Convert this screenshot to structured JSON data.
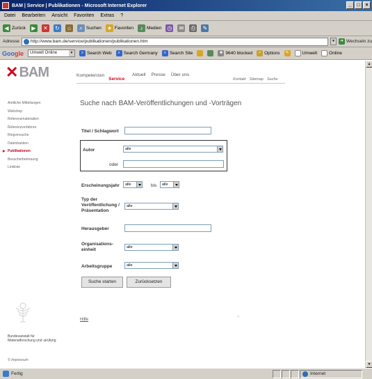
{
  "window": {
    "title": "BAM | Service | Publikationen - Microsoft Internet Explorer",
    "buttons": [
      "_",
      "□",
      "×"
    ]
  },
  "menubar": [
    "Datei",
    "Bearbeiten",
    "Ansicht",
    "Favoriten",
    "Extras",
    "?"
  ],
  "toolbar": {
    "back": "Zurück",
    "search": "Suchen",
    "favorites": "Favoriten",
    "media": "Medien"
  },
  "addressbar": {
    "label": "Adresse",
    "url": "http://www.bam.de/service/publikationen/publikationen.htm",
    "go": "Wechseln zu"
  },
  "googlebar": {
    "logo_main": "Goo",
    "logo_accent": "gle",
    "select": "Umwelt Online",
    "search_web": "Search Web",
    "search_germany": "Search Germany",
    "search_site": "Search Site",
    "blocked": "9640 blocked",
    "options": "Options",
    "umwelt": "Umwelt",
    "online": "Online"
  },
  "site": {
    "logo_text": "BAM",
    "nav": {
      "kompetenzen": "Kompetenzen",
      "service": "Service",
      "aktuell": "Aktuell",
      "presse": "Presse",
      "ueber_uns": "Über uns"
    },
    "util": {
      "kontakt": "Kontakt",
      "sitemap": "Sitemap",
      "suche": "Suche"
    },
    "sidebar": [
      "Amtliche Mitteilungen",
      "Webshop",
      "Referenzmaterialien",
      "Referenzverfahren",
      "Ringversuche",
      "Datenbanken",
      "Publikationen",
      "Besucherbetreuung",
      "Linkliste"
    ],
    "active_sidebar_index": 6,
    "org_name": "Bundesanstalt für Materialforschung und -prüfung",
    "impressum": "© Impressum"
  },
  "form": {
    "heading": "Suche nach BAM-Veröffentlichungen und -Vorträgen",
    "titel_label": "Titel / Schlagwort",
    "titel_value": "",
    "autor_label": "Autor",
    "autor_value": "alle",
    "oder_label": "oder",
    "oder_value": "",
    "jahr_label": "Erscheinungsjahr",
    "jahr_from": "alle",
    "bis_label": "bis",
    "jahr_to": "alle",
    "typ_label_1": "Typ der",
    "typ_label_2": "Veröffentlichung /",
    "typ_label_3": "Präsentation",
    "typ_value": "alle",
    "herausgeber_label": "Herausgeber",
    "herausgeber_value": "",
    "org_label_1": "Organisations-",
    "org_label_2": "einheit",
    "org_value": "alle",
    "gruppe_label": "Arbeitsgruppe",
    "gruppe_value": "alle",
    "submit": "Suche starten",
    "reset": "Zurücksetzen",
    "hilfe": "Hilfe",
    "top_arrow": "^"
  },
  "statusbar": {
    "status": "Fertig",
    "zone": "Internet"
  }
}
